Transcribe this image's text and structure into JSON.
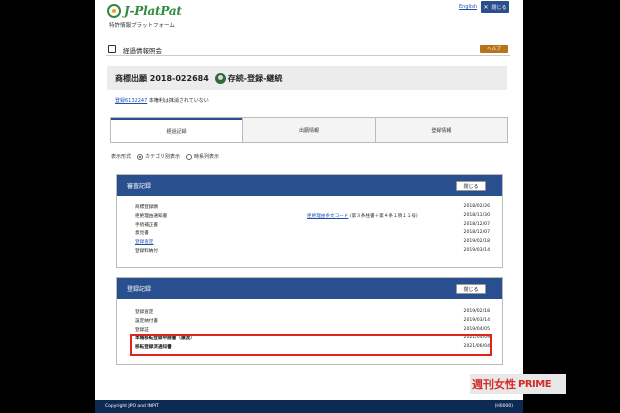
{
  "header": {
    "logo_text": "J-PlatPat",
    "logo_sub": "特許情報プラットフォーム",
    "lang_link": "English",
    "close_label": "閉じる"
  },
  "page": {
    "title": "経過情報照会",
    "help_label": "ヘルプ",
    "app_number": "商標出願 2018-022684",
    "status": "存続-登録-継続",
    "reg_link": "登録6132247",
    "reg_note": "本権利は抹消されていない"
  },
  "tabs": [
    {
      "label": "経過記録"
    },
    {
      "label": "出願情報"
    },
    {
      "label": "登録情報"
    }
  ],
  "view_mode": {
    "label": "表示形式",
    "options": [
      "カテゴリ別表示",
      "時系列表示"
    ],
    "selected": "カテゴリ別表示"
  },
  "panels": [
    {
      "title": "審査記録",
      "close_label": "閉じる",
      "rows": [
        {
          "name": "商標登録願",
          "note": "",
          "date": "2018/02/26",
          "link": false
        },
        {
          "name": "拒絶理由通知書",
          "note_link": "拒絶理由条文コード",
          "note": "(第３条柱書＋第４条１項１１号)",
          "date": "2018/11/30",
          "link": false
        },
        {
          "name": "手続補正書",
          "note": "",
          "date": "2018/12/07",
          "link": false
        },
        {
          "name": "意見書",
          "note": "",
          "date": "2018/12/07",
          "link": false
        },
        {
          "name": "登録査定",
          "note": "",
          "date": "2019/02/18",
          "link": true
        },
        {
          "name": "登録料納付",
          "note": "",
          "date": "2019/03/14",
          "link": false
        }
      ]
    },
    {
      "title": "登録記録",
      "close_label": "閉じる",
      "rows": [
        {
          "name": "登録査定",
          "date": "2019/02/18"
        },
        {
          "name": "設定納付書",
          "date": "2019/03/14"
        },
        {
          "name": "登録証",
          "date": "2019/04/05"
        },
        {
          "name": "本権移転登録申請書（譲渡）",
          "date": "2021/04/09",
          "bold": true
        },
        {
          "name": "移転登録済通知書",
          "date": "2021/06/04",
          "bold": true
        }
      ]
    }
  ],
  "watermark": {
    "part_a": "週刊女性",
    "part_b": "PRIME"
  },
  "footer": {
    "copyright": "Copyright JPO and INPIT",
    "code": "(H0000)"
  },
  "colors": {
    "primary": "#2a4f8f",
    "highlight": "#e0261b",
    "help": "#b8741a"
  }
}
